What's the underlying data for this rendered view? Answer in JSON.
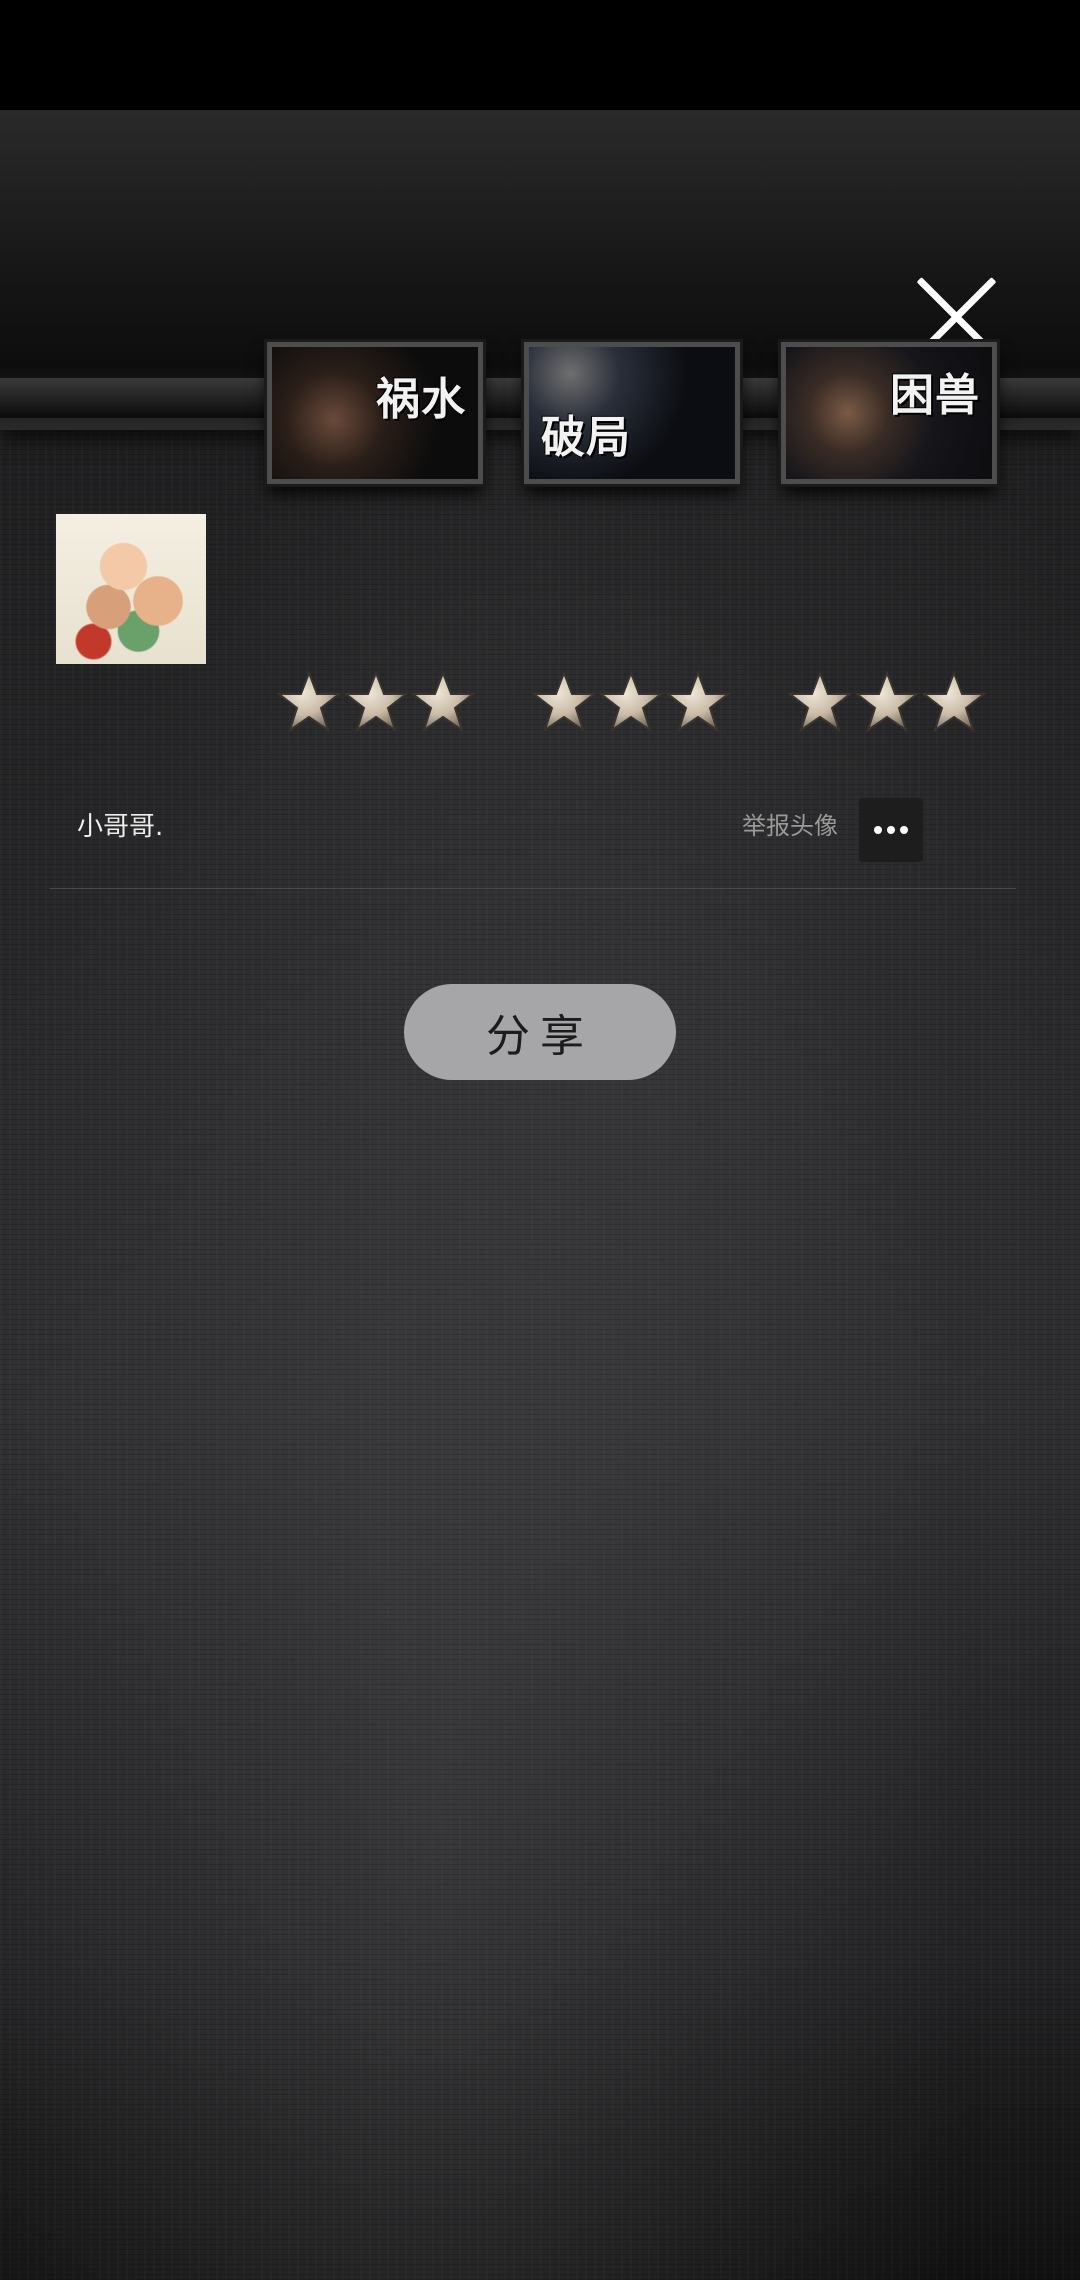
{
  "levels": [
    {
      "title": "祸水",
      "stars": 3
    },
    {
      "title": "破局",
      "stars": 3
    },
    {
      "title": "困兽",
      "stars": 3
    }
  ],
  "profile": {
    "username": "小哥哥.",
    "report_avatar_label": "举报头像"
  },
  "actions": {
    "share_label": "分享"
  },
  "icons": {
    "close": "close-icon",
    "more": "more-dots-icon",
    "star": "star-icon"
  },
  "colors": {
    "share_button_bg": "#a6a6a8",
    "star_fill": "#c9bba7"
  }
}
